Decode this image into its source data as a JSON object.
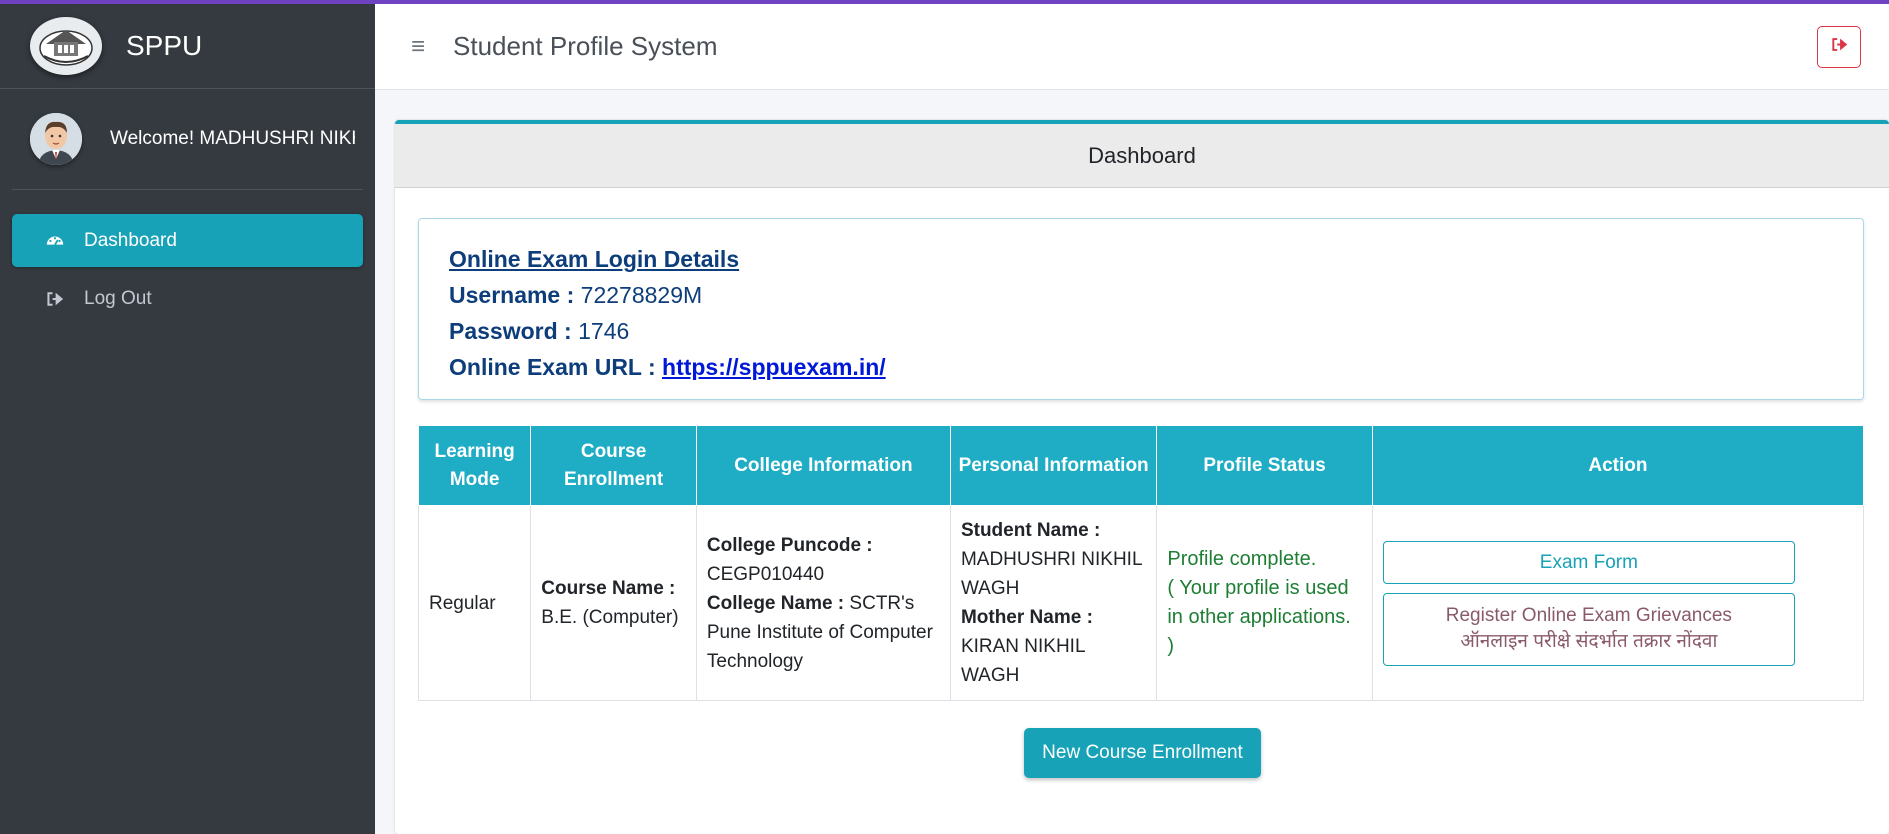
{
  "brand": {
    "name": "SPPU",
    "logo_icon": "university-emblem-icon"
  },
  "sidebar": {
    "welcome": "Welcome! MADHUSHRI NIKHIL WAGH",
    "items": [
      {
        "label": "Dashboard",
        "icon": "dashboard-icon",
        "active": true
      },
      {
        "label": "Log Out",
        "icon": "sign-out-icon",
        "active": false
      }
    ]
  },
  "header": {
    "title": "Student Profile System",
    "menu_icon": "hamburger-icon",
    "logout_icon": "sign-out-icon"
  },
  "card": {
    "title": "Dashboard"
  },
  "login": {
    "heading": "Online Exam Login Details",
    "username_label": "Username :",
    "username": "72278829M",
    "password_label": "Password :",
    "password": "1746",
    "url_label": "Online Exam URL :",
    "url": "https://sppuexam.in/"
  },
  "table": {
    "headers": [
      "Learning Mode",
      "Course Enrollment",
      "College Information",
      "Personal Information",
      "Profile Status",
      "Action"
    ],
    "row": {
      "learning_mode": "Regular",
      "course_label": "Course Name :",
      "course": "B.E. (Computer)",
      "puncode_label": "College Puncode :",
      "puncode": "CEGP010440",
      "college_label": "College Name :",
      "college": "SCTR's Pune Institute of Computer Technology",
      "student_label": "Student Name :",
      "student": "MADHUSHRI NIKHIL WAGH",
      "mother_label": "Mother Name :",
      "mother": "KIRAN NIKHIL WAGH",
      "status_line1": "Profile complete.",
      "status_line2": "( Your profile is used in other applications. )",
      "exam_form_button": "Exam Form",
      "grievance_button_en": "Register Online Exam Grievances",
      "grievance_button_mr": "ऑनलाइन परीक्षे संदर्भात तक्रार नोंदवा"
    }
  },
  "new_enrollment_button": "New Course Enrollment",
  "colors": {
    "accent": "#17a2b8",
    "sidebar": "#343a40",
    "status_green": "#1e7e34",
    "login_text": "#0d3d7a",
    "danger": "#dc3545"
  }
}
